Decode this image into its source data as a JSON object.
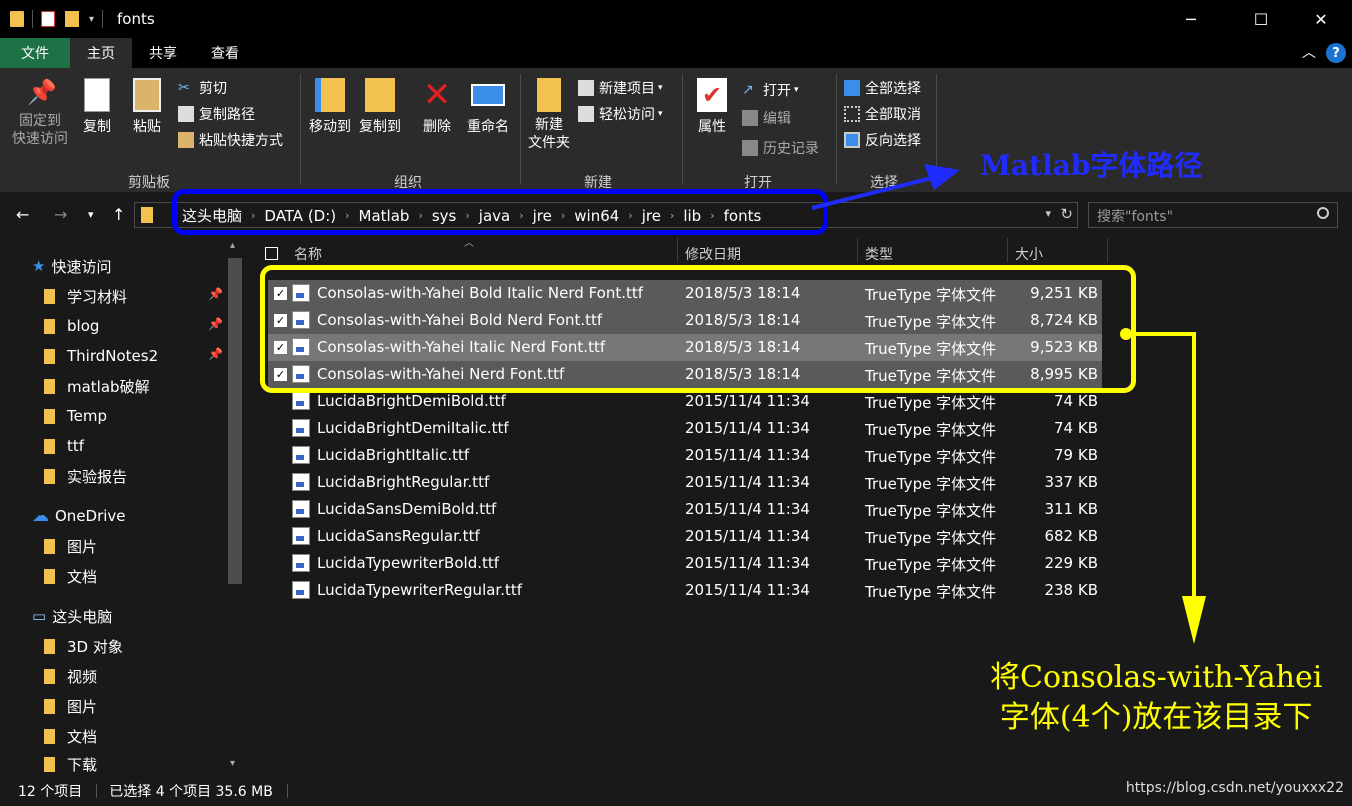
{
  "window": {
    "title": "fonts",
    "minimize": "─",
    "maximize": "☐",
    "close": "✕"
  },
  "ribbon_tabs": [
    "文件",
    "主页",
    "共享",
    "查看"
  ],
  "ribbon": {
    "clipboard": {
      "pin": "固定到\n快速访问",
      "copy": "复制",
      "paste": "粘贴",
      "cut": "剪切",
      "copy_path": "复制路径",
      "paste_shortcut": "粘贴快捷方式",
      "label": "剪贴板"
    },
    "organize": {
      "move_to": "移动到",
      "copy_to": "复制到",
      "delete": "删除",
      "rename": "重命名",
      "label": "组织"
    },
    "new": {
      "new_folder": "新建\n文件夹",
      "new_item": "新建项目",
      "easy_access": "轻松访问",
      "label": "新建"
    },
    "open": {
      "properties": "属性",
      "open": "打开",
      "edit": "编辑",
      "history": "历史记录",
      "label": "打开"
    },
    "select": {
      "select_all": "全部选择",
      "select_none": "全部取消",
      "invert": "反向选择",
      "label": "选择"
    }
  },
  "address": {
    "crumbs": [
      "这头电脑",
      "DATA (D:)",
      "Matlab",
      "sys",
      "java",
      "jre",
      "win64",
      "jre",
      "lib",
      "fonts"
    ],
    "search_placeholder": "搜索\"fonts\""
  },
  "nav": [
    {
      "label": "快速访问",
      "type": "quick"
    },
    {
      "label": "学习材料",
      "pinned": true
    },
    {
      "label": "blog",
      "pinned": true
    },
    {
      "label": "ThirdNotes2",
      "pinned": true
    },
    {
      "label": "matlab破解"
    },
    {
      "label": "Temp"
    },
    {
      "label": "ttf"
    },
    {
      "label": "实验报告"
    },
    {
      "label": "OneDrive",
      "type": "onedrive"
    },
    {
      "label": "图片"
    },
    {
      "label": "文档"
    },
    {
      "label": "这头电脑",
      "type": "pc"
    },
    {
      "label": "3D 对象"
    },
    {
      "label": "视频"
    },
    {
      "label": "图片"
    },
    {
      "label": "文档"
    },
    {
      "label": "下载"
    }
  ],
  "columns": [
    "名称",
    "修改日期",
    "类型",
    "大小"
  ],
  "files": [
    {
      "name": "Consolas-with-Yahei Bold Italic Nerd Font.ttf",
      "date": "2018/5/3 18:14",
      "type": "TrueType 字体文件",
      "size": "9,251 KB",
      "selected": true
    },
    {
      "name": "Consolas-with-Yahei Bold Nerd Font.ttf",
      "date": "2018/5/3 18:14",
      "type": "TrueType 字体文件",
      "size": "8,724 KB",
      "selected": true
    },
    {
      "name": "Consolas-with-Yahei Italic Nerd Font.ttf",
      "date": "2018/5/3 18:14",
      "type": "TrueType 字体文件",
      "size": "9,523 KB",
      "selected": true
    },
    {
      "name": "Consolas-with-Yahei Nerd Font.ttf",
      "date": "2018/5/3 18:14",
      "type": "TrueType 字体文件",
      "size": "8,995 KB",
      "selected": true
    },
    {
      "name": "LucidaBrightDemiBold.ttf",
      "date": "2015/11/4 11:34",
      "type": "TrueType 字体文件",
      "size": "74 KB",
      "selected": false
    },
    {
      "name": "LucidaBrightDemiItalic.ttf",
      "date": "2015/11/4 11:34",
      "type": "TrueType 字体文件",
      "size": "74 KB",
      "selected": false
    },
    {
      "name": "LucidaBrightItalic.ttf",
      "date": "2015/11/4 11:34",
      "type": "TrueType 字体文件",
      "size": "79 KB",
      "selected": false
    },
    {
      "name": "LucidaBrightRegular.ttf",
      "date": "2015/11/4 11:34",
      "type": "TrueType 字体文件",
      "size": "337 KB",
      "selected": false
    },
    {
      "name": "LucidaSansDemiBold.ttf",
      "date": "2015/11/4 11:34",
      "type": "TrueType 字体文件",
      "size": "311 KB",
      "selected": false
    },
    {
      "name": "LucidaSansRegular.ttf",
      "date": "2015/11/4 11:34",
      "type": "TrueType 字体文件",
      "size": "682 KB",
      "selected": false
    },
    {
      "name": "LucidaTypewriterBold.ttf",
      "date": "2015/11/4 11:34",
      "type": "TrueType 字体文件",
      "size": "229 KB",
      "selected": false
    },
    {
      "name": "LucidaTypewriterRegular.ttf",
      "date": "2015/11/4 11:34",
      "type": "TrueType 字体文件",
      "size": "238 KB",
      "selected": false
    }
  ],
  "status": {
    "count": "12 个项目",
    "selection": "已选择 4 个项目 35.6 MB"
  },
  "annotations": {
    "path_label": "Matlab字体路径",
    "instruction_line1": "将Consolas-with-Yahei",
    "instruction_line2": "字体(4个)放在该目录下"
  },
  "watermark": "https://blog.csdn.net/youxxx22",
  "colors": {
    "highlight_blue": "#0000ff",
    "highlight_yellow": "#ffff00",
    "file_tab": "#1e7145",
    "folder": "#f2c14e"
  }
}
